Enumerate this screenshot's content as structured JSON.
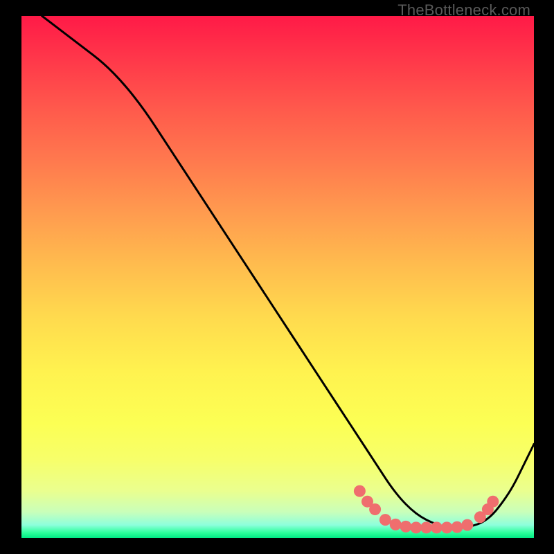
{
  "watermark": "TheBottleneck.com",
  "chart_data": {
    "type": "line",
    "title": "",
    "xlabel": "",
    "ylabel": "",
    "xlim": [
      0,
      100
    ],
    "ylim": [
      0,
      100
    ],
    "grid": false,
    "legend": false,
    "series": [
      {
        "name": "bottleneck-curve",
        "color": "#000000",
        "x": [
          4,
          8,
          12,
          16,
          20,
          24,
          28,
          32,
          36,
          40,
          44,
          48,
          52,
          56,
          60,
          64,
          66,
          68,
          70,
          72,
          74,
          76,
          78,
          80,
          82,
          84,
          86,
          88,
          90,
          92,
          94,
          96,
          98,
          100
        ],
        "y": [
          100,
          97,
          94,
          91,
          87,
          82,
          76,
          70,
          64,
          58,
          52,
          46,
          40,
          34,
          28,
          22,
          19,
          16,
          13,
          10,
          7.5,
          5.5,
          4,
          3,
          2.3,
          2,
          2,
          2.3,
          3,
          4.5,
          7,
          10,
          14,
          18
        ]
      }
    ],
    "markers": {
      "name": "highlight-dots",
      "color": "#ef6e6e",
      "points": [
        {
          "x": 66,
          "y": 9
        },
        {
          "x": 67.5,
          "y": 7
        },
        {
          "x": 69,
          "y": 5.5
        },
        {
          "x": 71,
          "y": 3.5
        },
        {
          "x": 73,
          "y": 2.6
        },
        {
          "x": 75,
          "y": 2.2
        },
        {
          "x": 77,
          "y": 2.0
        },
        {
          "x": 79,
          "y": 2.0
        },
        {
          "x": 81,
          "y": 2.0
        },
        {
          "x": 83,
          "y": 2.0
        },
        {
          "x": 85,
          "y": 2.1
        },
        {
          "x": 87,
          "y": 2.5
        },
        {
          "x": 89.5,
          "y": 4.0
        },
        {
          "x": 91,
          "y": 5.5
        },
        {
          "x": 92,
          "y": 7.0
        }
      ]
    },
    "background_gradient": {
      "top": "#ff1a47",
      "mid": "#fff24f",
      "bottom": "#00e884"
    }
  }
}
